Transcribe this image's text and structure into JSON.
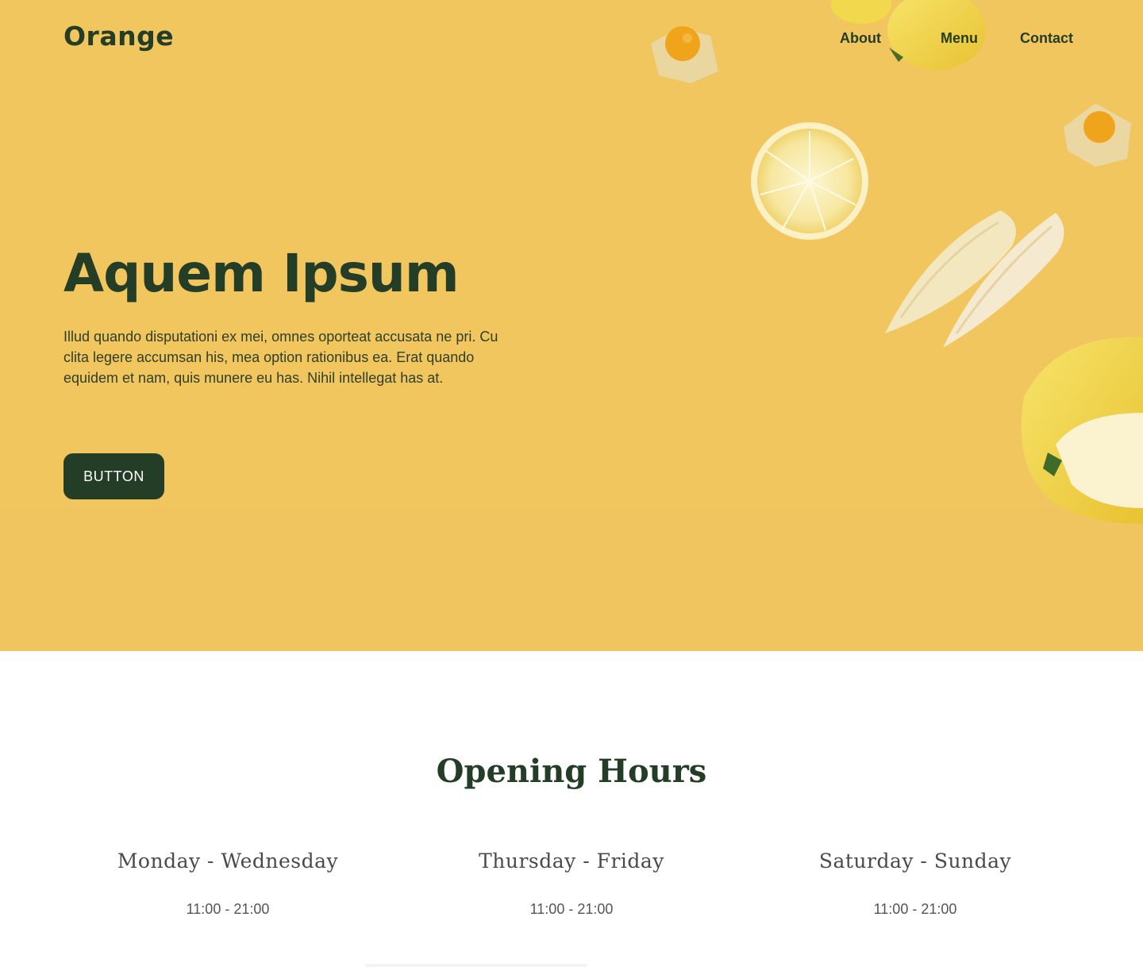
{
  "header": {
    "logo": "Orange",
    "nav": [
      "About",
      "Menu",
      "Contact"
    ]
  },
  "hero": {
    "title": "Aquem Ipsum",
    "text": "Illud quando disputationi ex mei, omnes oporteat accusata ne pri. Cu clita legere accumsan his, mea option rationibus ea. Erat quando equidem et nam, quis munere eu has. Nihil intellegat has at.",
    "button": "BUTTON",
    "background_color": "#f1c65f",
    "accent_color": "#243d26"
  },
  "hours": {
    "title": "Opening Hours",
    "columns": [
      {
        "days": "Monday - Wednesday",
        "time": "11:00 - 21:00"
      },
      {
        "days": "Thursday - Friday",
        "time": "11:00 - 21:00"
      },
      {
        "days": "Saturday - Sunday",
        "time": "11:00 - 21:00"
      }
    ]
  }
}
